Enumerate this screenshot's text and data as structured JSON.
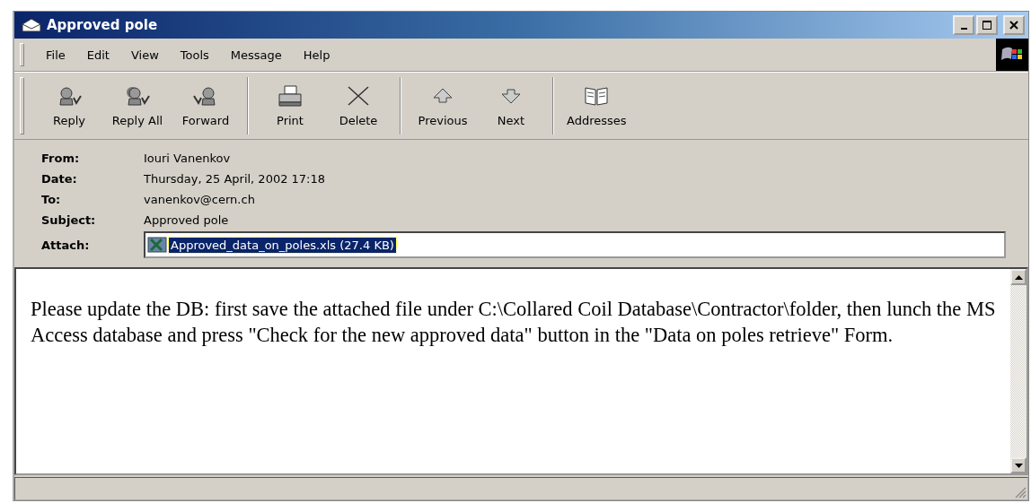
{
  "window": {
    "title": "Approved pole"
  },
  "menu": [
    "File",
    "Edit",
    "View",
    "Tools",
    "Message",
    "Help"
  ],
  "toolbar": [
    {
      "label": "Reply",
      "kind": "reply"
    },
    {
      "label": "Reply All",
      "kind": "replyall"
    },
    {
      "label": "Forward",
      "kind": "forward"
    },
    {
      "label": "Print",
      "kind": "print",
      "group_start": true
    },
    {
      "label": "Delete",
      "kind": "delete"
    },
    {
      "label": "Previous",
      "kind": "previous",
      "group_start": true
    },
    {
      "label": "Next",
      "kind": "next"
    },
    {
      "label": "Addresses",
      "kind": "addresses",
      "group_start": true
    }
  ],
  "headers": [
    {
      "label": "From:",
      "value": "Iouri Vanenkov"
    },
    {
      "label": "Date:",
      "value": "Thursday, 25 April, 2002 17:18"
    },
    {
      "label": "To:",
      "value": "vanenkov@cern.ch"
    },
    {
      "label": "Subject:",
      "value": "Approved pole"
    }
  ],
  "attach": {
    "label": "Attach:",
    "file": "Approved_data_on_poles.xls (27.4 KB)",
    "selected": true
  },
  "body": "Please update the DB: first save the attached file under C:\\Collared Coil Database\\Contractor\\folder, then lunch the MS Access database and press \"Check for the new approved data\" button in the \"Data on poles retrieve\" Form."
}
